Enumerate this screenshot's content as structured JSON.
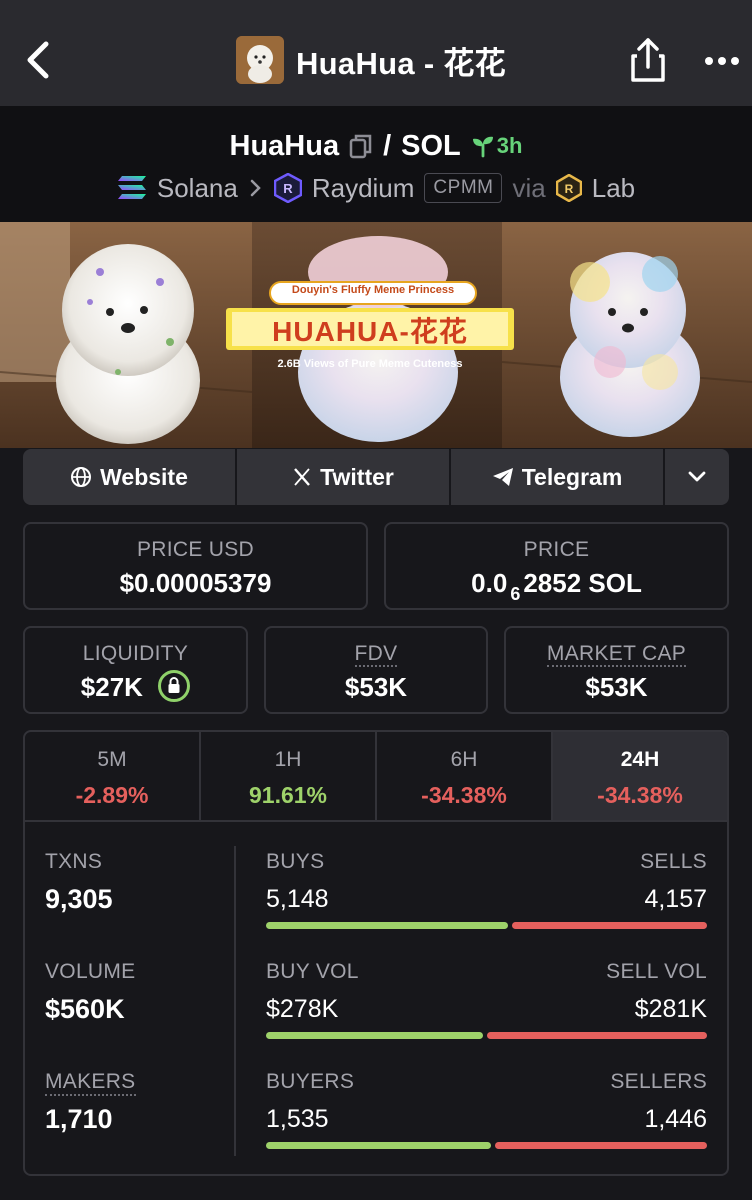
{
  "nav": {
    "title": "HuaHua - 花花"
  },
  "pair": {
    "base": "HuaHua",
    "slash": "/",
    "quote": "SOL",
    "age": "3h",
    "chain": "Solana",
    "dex": "Raydium",
    "pool_type": "CPMM",
    "via": "via",
    "via_source": "Lab"
  },
  "banner": {
    "tagline": "Douyin's Fluffy Meme Princess",
    "logo_text": "HUAHUA-花花",
    "subtitle": "2.6B Views of Pure Meme Cuteness"
  },
  "links": {
    "website": "Website",
    "twitter": "Twitter",
    "telegram": "Telegram"
  },
  "stats": {
    "price_usd_label": "PRICE USD",
    "price_usd": "$0.00005379",
    "price_label": "PRICE",
    "price_prefix": "0.0",
    "price_zeros": "6",
    "price_rest": "2852 SOL",
    "liquidity_label": "LIQUIDITY",
    "liquidity": "$27K",
    "fdv_label": "FDV",
    "fdv": "$53K",
    "mcap_label": "MARKET CAP",
    "mcap": "$53K"
  },
  "timeframes": [
    {
      "label": "5M",
      "change": "-2.89%",
      "color": "#e5605d"
    },
    {
      "label": "1H",
      "change": "91.61%",
      "color": "#9ed26a"
    },
    {
      "label": "6H",
      "change": "-34.38%",
      "color": "#e5605d"
    },
    {
      "label": "24H",
      "change": "-34.38%",
      "color": "#e5605d"
    }
  ],
  "activity": {
    "txns_label": "TXNS",
    "txns": "9,305",
    "volume_label": "VOLUME",
    "volume": "$560K",
    "makers_label": "MAKERS",
    "makers": "1,710",
    "buys_label": "BUYS",
    "buys": "5,148",
    "sells_label": "SELLS",
    "sells": "4,157",
    "buys_share": 0.553,
    "buy_vol_label": "BUY VOL",
    "buy_vol": "$278K",
    "sell_vol_label": "SELL VOL",
    "sell_vol": "$281K",
    "buy_vol_share": 0.497,
    "buyers_label": "BUYERS",
    "buyers": "1,535",
    "sellers_label": "SELLERS",
    "sellers": "1,446",
    "buyers_share": 0.515
  },
  "colors": {
    "positive": "#9ed26a",
    "negative": "#e5605d",
    "age_green": "#67d37a"
  }
}
